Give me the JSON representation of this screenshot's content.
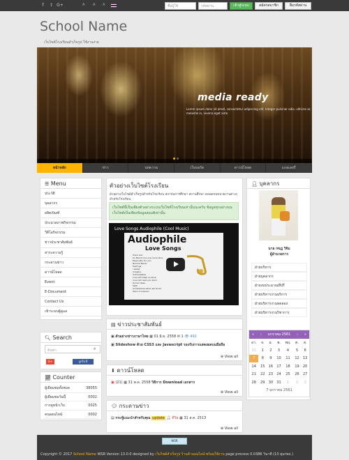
{
  "topbar": {
    "social_icons": [
      "facebook-icon",
      "twitter-icon",
      "google-plus-icon"
    ],
    "font_sizes": [
      "A",
      "A",
      "A"
    ],
    "username_placeholder": "ชื่อผู้ใช้",
    "password_placeholder": "รหัสผ่าน",
    "login_label": "เข้าสู่ระบบ",
    "register_label": "สมัครสมาชิก",
    "forgot_label": "ลืมรหัสผ่าน"
  },
  "header": {
    "title": "School Name",
    "subtitle": "เว็บไซต์โรงเรียนสำเร็จรูป ใช้งานง่าย"
  },
  "banner": {
    "headline": "media ready",
    "text": "Lorem ipsum dolor sit amet, consectetur adipiscing elit. Integer pulvinar odio, ultrices ac molestie in, viverra eget ante."
  },
  "nav": {
    "items": [
      "หน้าหลัก",
      "ข่าว",
      "บทความ",
      "เว็บบอร์ด",
      "ดาวน์โหลด",
      "แกลเลอรี่"
    ]
  },
  "menu": {
    "heading": "Menu",
    "items": [
      "ประวัติ",
      "บุคลากร",
      "ผลิตภัณฑ์",
      "ประมวลภาพกิจกรรม",
      "วีดีโอกิจกรรม",
      "ข่าวประชาสัมพันธ์",
      "สาระความรู้",
      "กระดานข่าว",
      "ดาวน์โหลด",
      "Event",
      "E-Document",
      "Contact Us",
      "เข้าระบบผู้ดูแล"
    ]
  },
  "search": {
    "heading": "Search",
    "placeholder": "ค้นหา",
    "gplus_label": "G+",
    "fb_label": "ถูกใจ 0"
  },
  "counter": {
    "heading": "Counter",
    "rows": [
      {
        "label": "ผู้เยี่ยมชมทั้งหมด",
        "value": "38055"
      },
      {
        "label": "ผู้เยี่ยมชมวันนี้",
        "value": "0002"
      },
      {
        "label": "การดูหน้าเว็บ",
        "value": "0025"
      },
      {
        "label": "คนออนไลน์",
        "value": "0002"
      }
    ]
  },
  "main": {
    "heading": "ตัวอย่างเว็บไซต์โรงเรียน",
    "description": "ตัวอย่างเว็บไซต์สำเร็จรูปสำหรับโรงเรียน สถาบันการศึกษา สถานศึกษา ตลอดจนหน่วยงานต่างๆ สำหรับโรงเรียน",
    "info": "เว็บไซต์นี้เป็นเพียงตัวอย่างระบบเว็บไซต์โรงเรียนเท่านั้นนะครับ ข้อมูลทุกอย่างบนเว็บไซต์เป็นเพียงข้อมูลสมมติเท่านั้น",
    "video": {
      "title": "Love Songs Audiophile (Cool Music)",
      "poster_title": "Audiophile",
      "poster_sub": "Love Songs",
      "tracks": [
        "Track List",
        "So Bad to me one more time",
        "Especially for you",
        "Normal Never",
        "Feelings",
        "I swear",
        "Imagine",
        "Unbreakable",
        "Love will keep us alive",
        "Love will lead you back",
        "Grown deep",
        "Faith",
        "Somewhere when we touch",
        "Tears in heaven"
      ]
    }
  },
  "pr_news": {
    "heading": "ข่าวประชาสัมพันธ์",
    "items": [
      {
        "title": "ตัวอย่างข่าวภาษาไทย",
        "date": "01 มิ.ย. 2558",
        "comments": "1",
        "views": "492"
      },
      {
        "title": "Slideshow ด้วย CSS3 และ Javascript รองรับการแสดงผลบนมือถือ",
        "date": "",
        "comments": "",
        "views": ""
      }
    ],
    "view_all": "View all"
  },
  "downloads": {
    "heading": "ดาวน์โหลด",
    "items": [
      {
        "count": "(21)",
        "date": "31 พ.ค. 2558",
        "title": "วิธีการ Download เอกสาร"
      }
    ],
    "view_all": "View all"
  },
  "board": {
    "heading": "กระดานข่าว",
    "items": [
      {
        "title": "กระทู้แนะนำสำหรับคุณ",
        "badge": "update",
        "author": "ดีวิธ",
        "date": "31 ส.ค. 2513"
      }
    ],
    "view_all": "View all"
  },
  "personnel": {
    "heading": "บุคลากร",
    "name": "นาย กขฎ วิจิม",
    "position": "ผู้อำนวยการ",
    "groups": [
      "ฝ่ายบริหาร",
      "ฝ่ายบุคลากร",
      "ฝ่ายงบประมาณที่ปรึ",
      "ฝ่ายบริหารงานบริการ",
      "ฝ่ายบริหารงานทดลอง",
      "ฝ่ายบริหารงานวิชาการ"
    ]
  },
  "calendar": {
    "month_label": "มกราคม 2561",
    "weekdays": [
      "อา.",
      "จ.",
      "อ.",
      "พ.",
      "พฤ.",
      "ศ.",
      "ส."
    ],
    "weeks": [
      [
        "31",
        "1",
        "2",
        "3",
        "4",
        "5",
        "6"
      ],
      [
        "7",
        "8",
        "9",
        "10",
        "11",
        "12",
        "13"
      ],
      [
        "14",
        "15",
        "16",
        "17",
        "18",
        "19",
        "20"
      ],
      [
        "21",
        "22",
        "23",
        "24",
        "25",
        "26",
        "27"
      ],
      [
        "28",
        "29",
        "30",
        "31",
        "1",
        "2",
        "3"
      ]
    ],
    "today": "7",
    "footer": "7 มกราคม 2561"
  },
  "footer": {
    "logo_label": "WSR",
    "copyright_prefix": "Copyright © 2017",
    "school_name": "School Name",
    "version": "WSR Version 13.0.0 designed by",
    "designer": "เว็บไซต์สำเร็จรูป ร้านค้าออนไลน์ พร้อมใช้งาน",
    "process": "page process 0.0386 วินาที (13 quries.)"
  },
  "colors": {
    "accent": "#ffb400",
    "topbar": "#3a3a3a",
    "login_green": "#5cb85c",
    "calendar_purple": "#9461b8"
  }
}
